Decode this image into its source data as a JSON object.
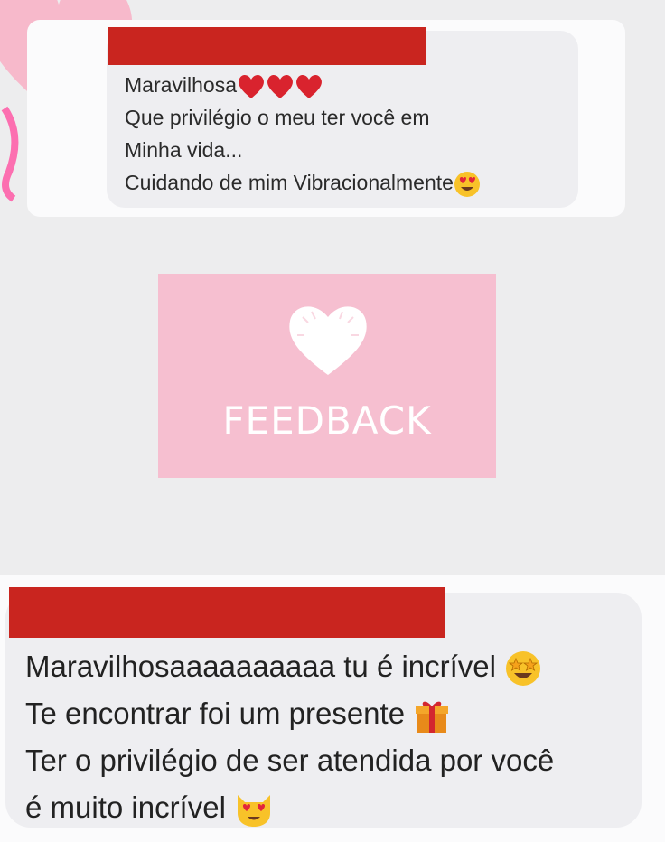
{
  "message_top": {
    "lines": [
      "Maravilhosa",
      "Que privilégio o meu ter você em",
      "Minha vida...",
      "Cuidando de mim Vibracionalmente"
    ],
    "line1_emojis": [
      "red-heart-emoji",
      "red-heart-emoji",
      "red-heart-emoji"
    ],
    "line4_emoji": "heart-eyes-emoji"
  },
  "feedback_card": {
    "label": "FEEDBACK",
    "icon": "heart-icon",
    "background": "#f6bfd0"
  },
  "message_bottom": {
    "lines": [
      "Maravilhosaaaaaaaaaa tu é incrível",
      "Te encontrar foi um presente",
      "Ter o privilégio de ser atendida por você",
      "é muito incrível"
    ],
    "line1_emoji": "star-struck-emoji",
    "line2_emoji": "gift-emoji",
    "line4_emoji": "heart-eyes-cat-emoji"
  },
  "colors": {
    "redaction": "#c9251f",
    "bubble": "#eeeef1",
    "background": "#ededee"
  }
}
